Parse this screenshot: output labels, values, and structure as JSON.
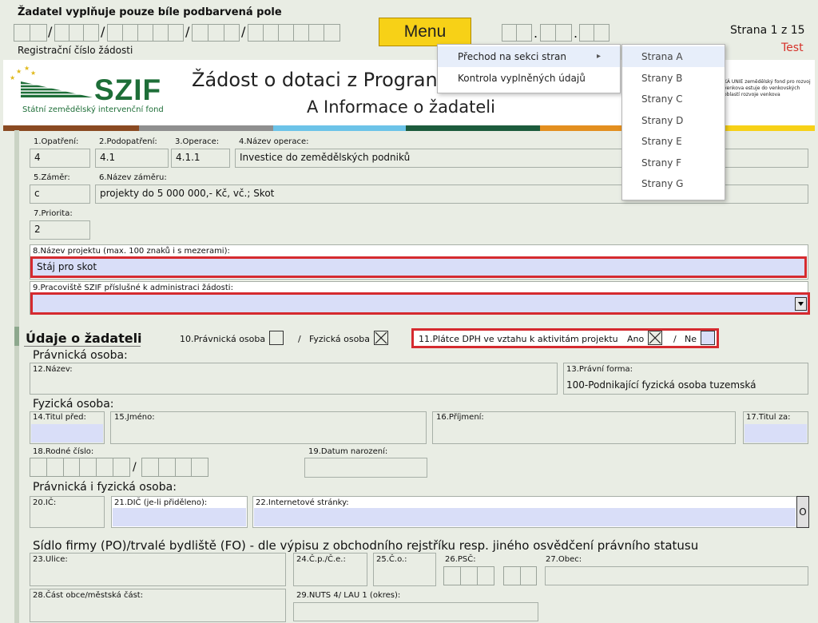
{
  "header": {
    "note": "Žadatel vyplňuje pouze bíle podbarvená pole",
    "reg_label": "Registrační číslo žádosti",
    "reg_sep": "/",
    "menu_label": "Menu",
    "date_sep": ".",
    "page_info": "Strana 1 z 15",
    "test_label": "Test"
  },
  "title": {
    "logo": "SZIF",
    "logo_sub": "Státní zemědělský intervenční fond",
    "line1": "Žádost o dotaci z Progran",
    "line2": "A Informace o žadateli",
    "eu_text": "KÁ UNIE zemědělský fond pro rozvoj venkova estuje do venkovských oblastí rozvoje venkova"
  },
  "colors": {
    "strip": [
      "#8a4a22",
      "#8f8f8f",
      "#6cc3e8",
      "#1c5b3c",
      "#e38f1f",
      "#f7d117"
    ],
    "highlight_border": "#d52a2f",
    "input_blue": "#d9def8",
    "menu_yellow": "#f7d117"
  },
  "menu": {
    "items": [
      {
        "label": "Přechod na sekci stran",
        "arrow": "▸"
      },
      {
        "label": "Kontrola vyplněných údajů"
      }
    ],
    "submenu": [
      "Strana A",
      "Strany B",
      "Strany C",
      "Strany D",
      "Strany E",
      "Strany F",
      "Strany G"
    ]
  },
  "form": {
    "f1": {
      "label": "1.Opatření:",
      "value": "4"
    },
    "f2": {
      "label": "2.Podopatření:",
      "value": "4.1"
    },
    "f3": {
      "label": "3.Operace:",
      "value": "4.1.1"
    },
    "f4": {
      "label": "4.Název operace:",
      "value": "Investice do zemědělských podniků"
    },
    "f5": {
      "label": "5.Záměr:",
      "value": "c"
    },
    "f6": {
      "label": "6.Název záměru:",
      "value": "projekty do 5 000 000,- Kč, vč.; Skot"
    },
    "f7": {
      "label": "7.Priorita:",
      "value": "2"
    },
    "f8": {
      "label": "8.Název projektu (max. 100 znaků i s mezerami):",
      "value": "Stáj pro skot"
    },
    "f9": {
      "label": "9.Pracoviště SZIF příslušné k administraci žádosti:",
      "value": ""
    },
    "section_title": "Údaje o žadateli",
    "f10": {
      "label_po": "10.Právnická osoba",
      "sep": "/",
      "label_fo": "Fyzická osoba"
    },
    "f11": {
      "label": "11.Plátce DPH ve vztahu k aktivitám projektu",
      "ano": "Ano",
      "sep": "/",
      "ne": "Ne"
    },
    "po_title": "Právnická osoba:",
    "f12": {
      "label": "12.Název:",
      "value": ""
    },
    "f13": {
      "label": "13.Právní forma:",
      "value": "100-Podnikající fyzická osoba tuzemská"
    },
    "fo_title": "Fyzická osoba:",
    "f14": {
      "label": "14.Titul před:"
    },
    "f15": {
      "label": "15.Jméno:"
    },
    "f16": {
      "label": "16.Příjmení:"
    },
    "f17": {
      "label": "17.Titul za:"
    },
    "f18": {
      "label": "18.Rodné číslo:",
      "sep": "/"
    },
    "f19": {
      "label": "19.Datum narození:"
    },
    "pofo_title": "Právnická i fyzická osoba:",
    "f20": {
      "label": "20.IČ:"
    },
    "f21": {
      "label": "21.DIČ (je-li přiděleno):"
    },
    "f22": {
      "label": "22.Internetové stránky:",
      "button": "O"
    },
    "addr_title": "Sídlo firmy (PO)/trvalé bydliště (FO) - dle výpisu z obchodního rejstříku resp. jiného osvědčení právního statusu",
    "f23": {
      "label": "23.Ulice:"
    },
    "f24": {
      "label": "24.Č.p./Č.e.:"
    },
    "f25": {
      "label": "25.Č.o.:"
    },
    "f26": {
      "label": "26.PSČ:"
    },
    "f27": {
      "label": "27.Obec:"
    },
    "f28": {
      "label": "28.Část obce/městská část:"
    },
    "f29": {
      "label": "29.NUTS 4/ LAU 1 (okres):"
    }
  }
}
